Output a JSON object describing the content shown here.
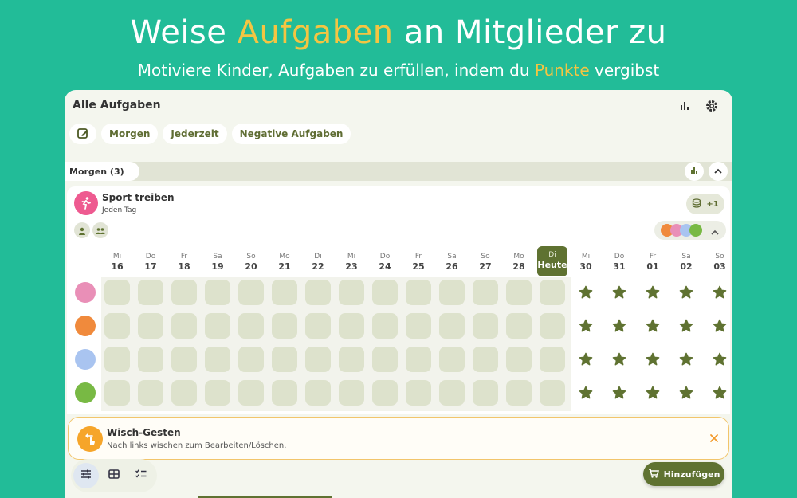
{
  "hero": {
    "title_pre": "Weise ",
    "title_hl": "Aufgaben",
    "title_post": " an Mitglieder zu",
    "subtitle_pre": "Motiviere Kinder, Aufgaben zu erfüllen, indem du ",
    "subtitle_hl": "Punkte",
    "subtitle_post": " vergibst"
  },
  "header": {
    "title": "Alle Aufgaben",
    "icons": [
      "bar-chart-icon",
      "gear-icon"
    ]
  },
  "filters": {
    "edit_icon": "edit-icon",
    "chips": [
      "Morgen",
      "Jederzeit",
      "Negative Aufgaben"
    ]
  },
  "section": {
    "label": "Morgen (3)"
  },
  "task": {
    "name": "Sport treiben",
    "frequency": "Jeden Tag",
    "points": "+1",
    "icon": "running-person-icon"
  },
  "days": [
    {
      "wd": "Mi",
      "dn": "16"
    },
    {
      "wd": "Do",
      "dn": "17"
    },
    {
      "wd": "Fr",
      "dn": "18"
    },
    {
      "wd": "Sa",
      "dn": "19"
    },
    {
      "wd": "So",
      "dn": "20"
    },
    {
      "wd": "Mo",
      "dn": "21"
    },
    {
      "wd": "Di",
      "dn": "22"
    },
    {
      "wd": "Mi",
      "dn": "23"
    },
    {
      "wd": "Do",
      "dn": "24"
    },
    {
      "wd": "Fr",
      "dn": "25"
    },
    {
      "wd": "Sa",
      "dn": "26"
    },
    {
      "wd": "So",
      "dn": "27"
    },
    {
      "wd": "Mo",
      "dn": "28"
    },
    {
      "wd": "Di",
      "dn": "Heute"
    },
    {
      "wd": "Mi",
      "dn": "30"
    },
    {
      "wd": "Do",
      "dn": "31"
    },
    {
      "wd": "Fr",
      "dn": "01"
    },
    {
      "wd": "Sa",
      "dn": "02"
    },
    {
      "wd": "So",
      "dn": "03"
    }
  ],
  "today_index": 13,
  "members": [
    {
      "name": "pink-monster-avatar",
      "color": "#e98fb7"
    },
    {
      "name": "fox-avatar",
      "color": "#f08a3c"
    },
    {
      "name": "blue-ghost-avatar",
      "color": "#a9c4f0"
    },
    {
      "name": "green-dino-avatar",
      "color": "#78b944"
    }
  ],
  "hint": {
    "title": "Wisch-Gesten",
    "text": "Nach links wischen zum Bearbeiten/Löschen."
  },
  "bottom_nav": {
    "icons": [
      "sliders-icon",
      "table-icon",
      "checklist-icon"
    ]
  },
  "add_button": {
    "label": "Hinzufügen",
    "icon": "cart-icon"
  },
  "colors": {
    "background": "#22bc98",
    "accent": "#5f7231",
    "highlight": "#f4c542",
    "cell": "#dde2cc"
  }
}
